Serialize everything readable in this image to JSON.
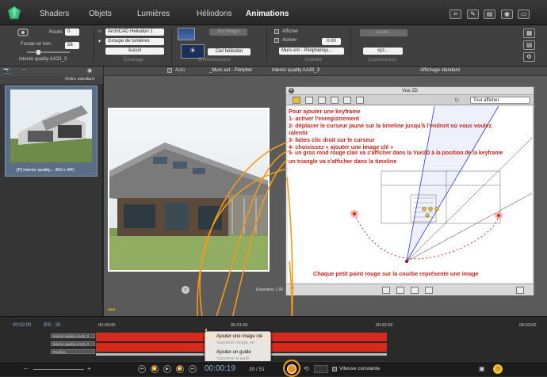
{
  "tabs": {
    "shaders": "Shaders",
    "objets": "Objets",
    "lumieres": "Lumières",
    "heliodons": "Héliodons",
    "animations": "Animations"
  },
  "toolbar": {
    "roulis_label": "Roulis",
    "roulis_value": "0",
    "focale_label": "Focale en mm",
    "focale_value": "58",
    "camera_name": "interior quality AA33_3",
    "heliodon_select": "ArchiCAD Heliodon 1",
    "groupe_select": "Groupe de lumières",
    "aucun_select": "Aucun",
    "eclairage_label": "Éclairage",
    "sur_image_btn": "Sur image",
    "ciel_select": "Ciel héliodon",
    "environnement_label": "Environnement",
    "afficher_label": "Afficher",
    "activer_label": "Activer",
    "visibility_value": "0.00",
    "layer_select": "Murs ext - Périphériqu...",
    "visibilite_label": "Visibilité",
    "laser_btn": "Laser...",
    "xyz_btn": "xyz...",
    "coordonnees_label": "Coordonnées"
  },
  "left_panel": {
    "sort": "Ordre standard",
    "thumb_caption": "[P] interior quality... 400 x 400"
  },
  "viewport": {
    "auto_label": "Auto",
    "layer_name": "_Murs ext - Périphér",
    "camera_name": "interior quality AA33_3",
    "display_mode": "Affichage standard",
    "exposure_label": "Exposition 1.00"
  },
  "vue2d": {
    "title": "Vue 2D",
    "show_all": "Tout afficher",
    "instructions": [
      "Pour ajouter une keyframe",
      "1- activer l'enregistrement",
      "2- déplacer le curseur jaune sur la timeline jusqu'à l'endroit où vous voulez",
      "ralentir",
      "3- faites clic droit sur le curseur",
      "4- choisissez « ajouter une image clé »",
      "5- un gros rond rouge clair va s'afficher dans la Vue2D à la position de la keyframe",
      "un triangle va s'afficher dans la timeline"
    ],
    "caption": "Chaque petit point rouge sur la courbe représente une image",
    "help": "?"
  },
  "timeline": {
    "time_start": "00:02:00",
    "ips_label": "IPS : 25",
    "ruler": [
      "00:00:00",
      "00:01:00",
      "00:02:00",
      "00:03:00"
    ],
    "tracks": [
      "interior quality AA33_3",
      "interior quality AA33_3",
      "Position"
    ]
  },
  "context_menu": {
    "items": [
      "Ajouter une image clé",
      "Supprimer l'image clé",
      "Ajouter un guide",
      "Supprimer le guide"
    ]
  },
  "bottom": {
    "timecode": "00:00:19",
    "frames": "20 / 51",
    "vitesse": "Vitesse constante"
  },
  "colors": {
    "accent_red": "#d72a1a",
    "annotation_orange": "#f39a1a",
    "instruction_red": "#c8261a",
    "path_blue": "#2a3bd9"
  }
}
